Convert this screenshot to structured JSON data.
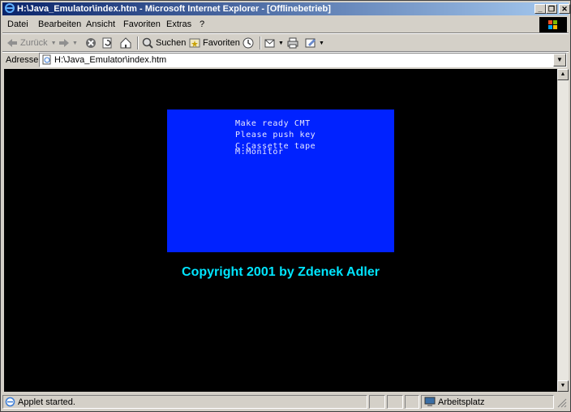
{
  "window": {
    "title": "H:\\Java_Emulator\\index.htm - Microsoft Internet Explorer - [Offlinebetrieb]",
    "minimize": "_",
    "maximize": "❐",
    "close": "✕"
  },
  "menu": {
    "items": [
      "Datei",
      "Bearbeiten",
      "Ansicht",
      "Favoriten",
      "Extras",
      "?"
    ]
  },
  "toolbar": {
    "back_label": "Zurück",
    "search_label": "Suchen",
    "favorites_label": "Favoriten"
  },
  "address": {
    "label": "Adresse",
    "value": "H:\\Java_Emulator\\index.htm"
  },
  "emulator": {
    "lines": [
      "Make ready CMT",
      "Please push key",
      "C:Cassette tape",
      "M:Monitor"
    ]
  },
  "page": {
    "copyright": "Copyright 2001 by Zdenek Adler"
  },
  "status": {
    "text": "Applet started.",
    "zone": "Arbeitsplatz"
  },
  "colors": {
    "titlebar_start": "#0a246a",
    "titlebar_end": "#a6caf0",
    "emulator_bg": "#0022ff",
    "copyright": "#00e5ff",
    "content_bg": "#000000"
  }
}
